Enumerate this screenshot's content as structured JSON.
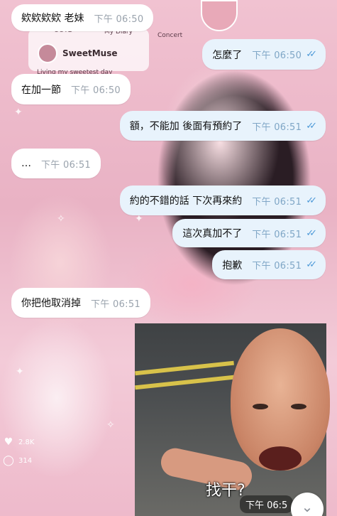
{
  "wallpaper": {
    "labels": {
      "left_top": "OOTD",
      "my_diary": "My Diary",
      "concert": "Concert",
      "muse_name": "SweetMuse",
      "muse_caption": "Living my sweetest day",
      "likes": "2.8K",
      "comments": "314"
    }
  },
  "messages": [
    {
      "dir": "in",
      "text": "欸欸欸欸 老妹",
      "time": "下午 06:50"
    },
    {
      "dir": "out",
      "text": "怎麼了",
      "time": "下午 06:50",
      "read": true
    },
    {
      "dir": "in",
      "text": "在加一節",
      "time": "下午 06:50"
    },
    {
      "dir": "out",
      "text": "額，不能加 後面有預約了",
      "time": "下午 06:51",
      "read": true
    },
    {
      "dir": "in",
      "text": "…",
      "time": "下午 06:51"
    },
    {
      "dir": "out",
      "text": "約的不錯的話 下次再來約",
      "time": "下午 06:51",
      "read": true
    },
    {
      "dir": "out",
      "text": "這次真加不了",
      "time": "下午 06:51",
      "read": true
    },
    {
      "dir": "out",
      "text": "抱歉",
      "time": "下午 06:51",
      "read": true
    },
    {
      "dir": "in",
      "text": "你把他取消掉",
      "time": "下午 06:51"
    }
  ],
  "sticker": {
    "caption": "找干?",
    "time": "下午 06:5"
  },
  "icons": {
    "read_receipt": "double-check-icon",
    "scroll_down": "chevron-down-icon",
    "heart": "heart-icon",
    "comment": "comment-icon"
  },
  "colors": {
    "incoming_bubble": "#ffffff",
    "outgoing_bubble": "#e8f3fc",
    "read_check": "#4e9ad8"
  }
}
